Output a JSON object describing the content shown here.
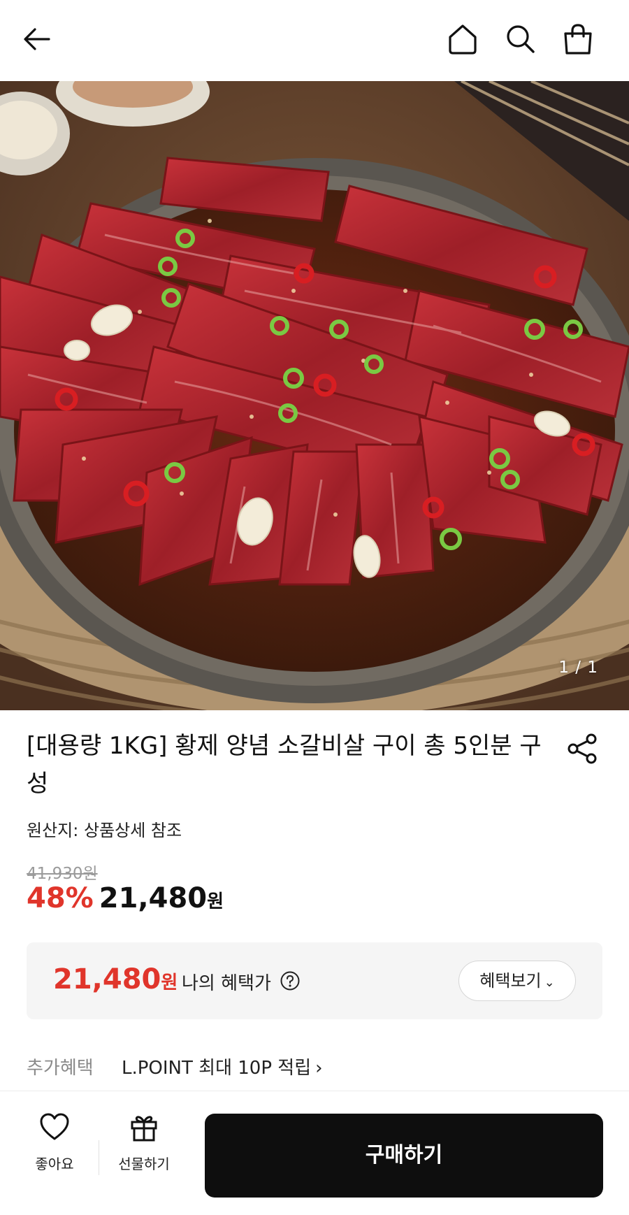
{
  "header": {
    "back_icon": "arrow-left-icon",
    "home_icon": "home-icon",
    "search_icon": "search-icon",
    "bag_icon": "shopping-bag-icon"
  },
  "hero": {
    "counter": "1 / 1",
    "description_icon": "product-photo"
  },
  "product": {
    "title": "[대용량 1KG] 황제 양념 소갈비살 구이 총 5인분 구성",
    "origin": "원산지: 상품상세 참조",
    "original_price": "41,930원",
    "discount_rate": "48%",
    "sale_price": "21,480",
    "currency": "원"
  },
  "benefit": {
    "price": "21,480",
    "currency": "원",
    "label": "나의 혜택가",
    "button_label": "혜택보기",
    "button_chevron": "⌄"
  },
  "extra": {
    "label": "추가혜택",
    "text": "L.POINT 최대 10P 적립",
    "chevron": "›"
  },
  "bottom": {
    "like_label": "좋아요",
    "gift_label": "선물하기",
    "buy_label": "구매하기"
  },
  "colors": {
    "accent_red": "#e0352b",
    "buy_button": "#0e0e0e"
  }
}
